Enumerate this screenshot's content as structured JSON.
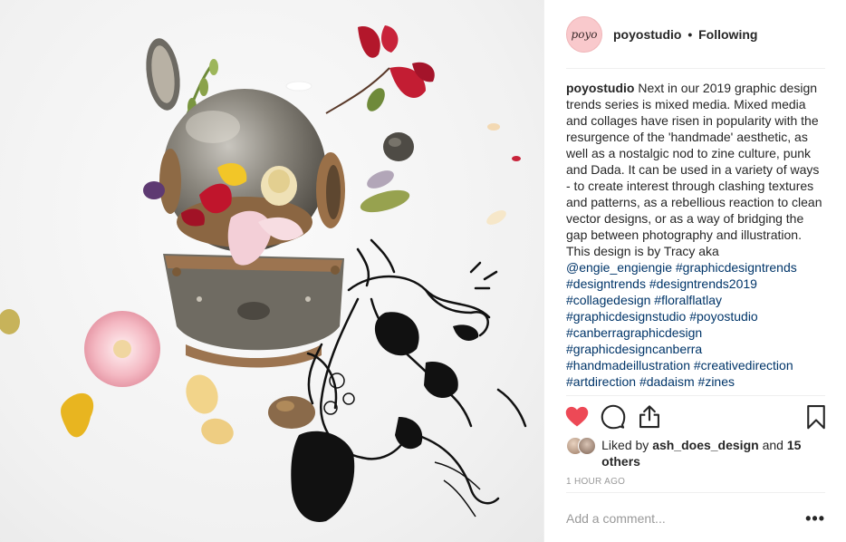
{
  "post": {
    "image_alt": "Mixed media collage with diving helmet, flowers and ink drawing",
    "header": {
      "avatar_text": "poyo",
      "username": "poyostudio",
      "separator": "•",
      "follow_status": "Following"
    },
    "caption": {
      "username": "poyostudio",
      "text": "Next in our 2019 graphic design trends series is mixed media. Mixed media and collages have risen in popularity with the resurgence of the 'handmade' aesthetic, as well as a nostalgic nod to zine culture, punk and Dada. It can be used in a variety of ways - to create interest through clashing textures and patterns, as a rebellious reaction to clean vector designs, or as a way of bridging the gap between photography and illustration. This design is by Tracy aka",
      "mention": "@engie_engiengie",
      "hashtags": [
        "#graphicdesigntrends",
        "#designtrends",
        "#designtrends2019",
        "#collagedesign",
        "#floralflatlay",
        "#graphicdesignstudio",
        "#poyostudio",
        "#canberragraphicdesign",
        "#graphicdesigncanberra",
        "#handmadeillustration",
        "#creativedirection",
        "#artdirection",
        "#dadaism",
        "#zines"
      ]
    },
    "actions": {
      "like_icon": "heart-filled-icon",
      "comment_icon": "comment-bubble-icon",
      "share_icon": "share-upload-icon",
      "save_icon": "bookmark-icon",
      "like_color": "#ed4956"
    },
    "likes": {
      "prefix": "Liked by",
      "user": "ash_does_design",
      "connector": "and",
      "others": "15 others"
    },
    "timestamp": "1 HOUR AGO",
    "comment": {
      "placeholder": "Add a comment...",
      "more_label": "•••"
    }
  }
}
